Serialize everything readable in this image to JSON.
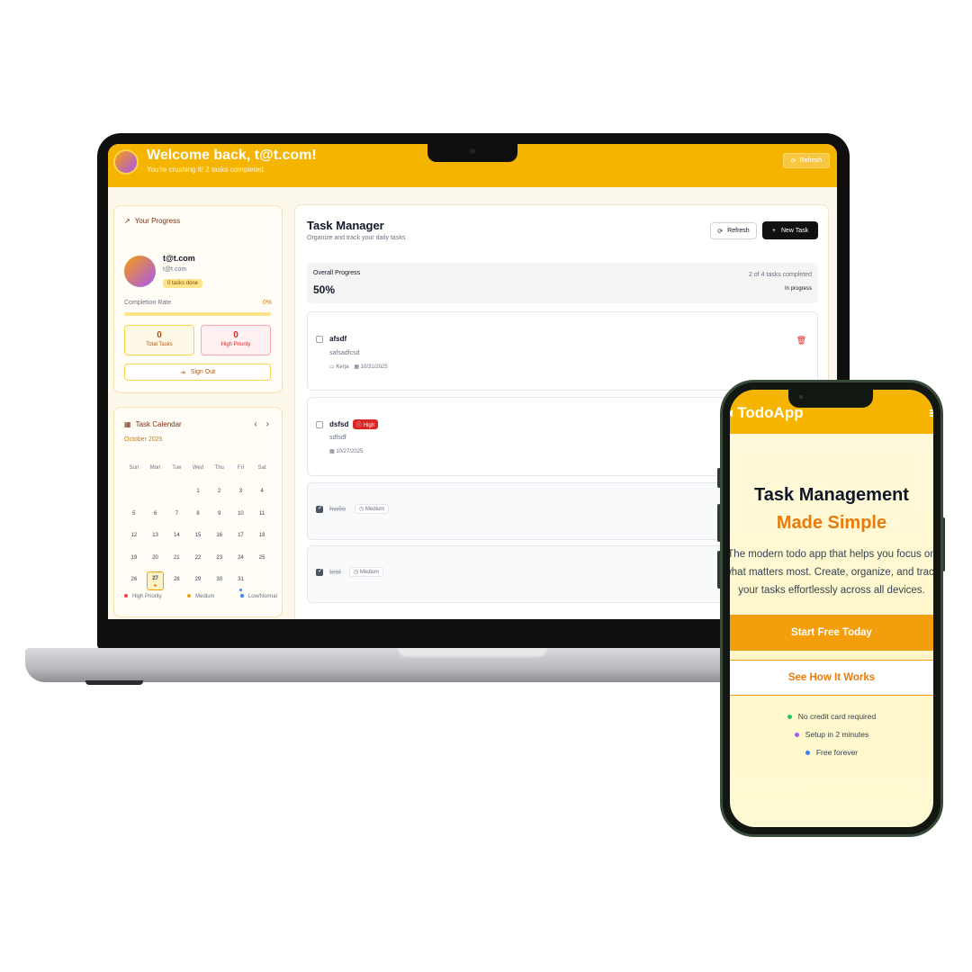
{
  "laptop": {
    "header": {
      "welcome": "Welcome back, t@t.com!",
      "subtitle": "You're crushing it! 2 tasks completed.",
      "refresh_label": "Refresh"
    },
    "progress": {
      "title": "Your Progress",
      "email": "t@t.com",
      "email_secondary": "t@t.com",
      "badge": "0 tasks done",
      "completion_label": "Completion Rate",
      "completion_value": "0%",
      "completion_fraction": 0,
      "total_tasks_value": "0",
      "total_tasks_label": "Total Tasks",
      "high_priority_value": "0",
      "high_priority_label": "High Priority",
      "sign_out_label": "Sign Out"
    },
    "calendar": {
      "title": "Task Calendar",
      "month": "October 2025",
      "weekdays": [
        "Sun",
        "Mon",
        "Tue",
        "Wed",
        "Thu",
        "Fri",
        "Sat"
      ],
      "leading_blanks": 3,
      "days_in_month": 31,
      "today": 27,
      "marked_days": [
        {
          "day": 27,
          "color": "#f59e0b"
        },
        {
          "day": 31,
          "color": "#3b82f6"
        }
      ],
      "legend": [
        {
          "label": "High Priority",
          "color": "#ef4444"
        },
        {
          "label": "Medium",
          "color": "#f59e0b"
        },
        {
          "label": "Low/Normal",
          "color": "#3b82f6"
        }
      ]
    },
    "task_manager": {
      "title": "Task Manager",
      "subtitle": "Organize and track your daily tasks",
      "refresh_label": "Refresh",
      "new_task_label": "New Task",
      "overall_label": "Overall Progress",
      "overall_value": "50%",
      "overall_count": "2 of 4 tasks completed",
      "overall_status": "In progress",
      "tasks": [
        {
          "name": "afsdf",
          "description": "safsadfcsd",
          "category": "Kerja",
          "date": "10/31/2025",
          "priority": "",
          "done": false
        },
        {
          "name": "dsfsd",
          "description": "sdfsdf",
          "category": "",
          "date": "10/27/2025",
          "priority": "High",
          "done": false
        },
        {
          "name": "hwllo",
          "description": "",
          "category": "",
          "date": "",
          "priority": "Medium",
          "done": true
        },
        {
          "name": "test",
          "description": "",
          "category": "",
          "date": "",
          "priority": "Medium",
          "done": true
        }
      ]
    }
  },
  "phone": {
    "logo": "TodoApp",
    "headline_1": "Task Management",
    "headline_2": "Made Simple",
    "description": "The modern todo app that helps you focus on what matters most. Create, organize, and track your tasks effortlessly across all devices.",
    "cta_primary": "Start Free Today",
    "cta_secondary": "See How It Works",
    "features": [
      {
        "label": "No credit card required",
        "color": "#22c55e"
      },
      {
        "label": "Setup in 2 minutes",
        "color": "#a855f7"
      },
      {
        "label": "Free forever",
        "color": "#3b82f6"
      }
    ]
  }
}
